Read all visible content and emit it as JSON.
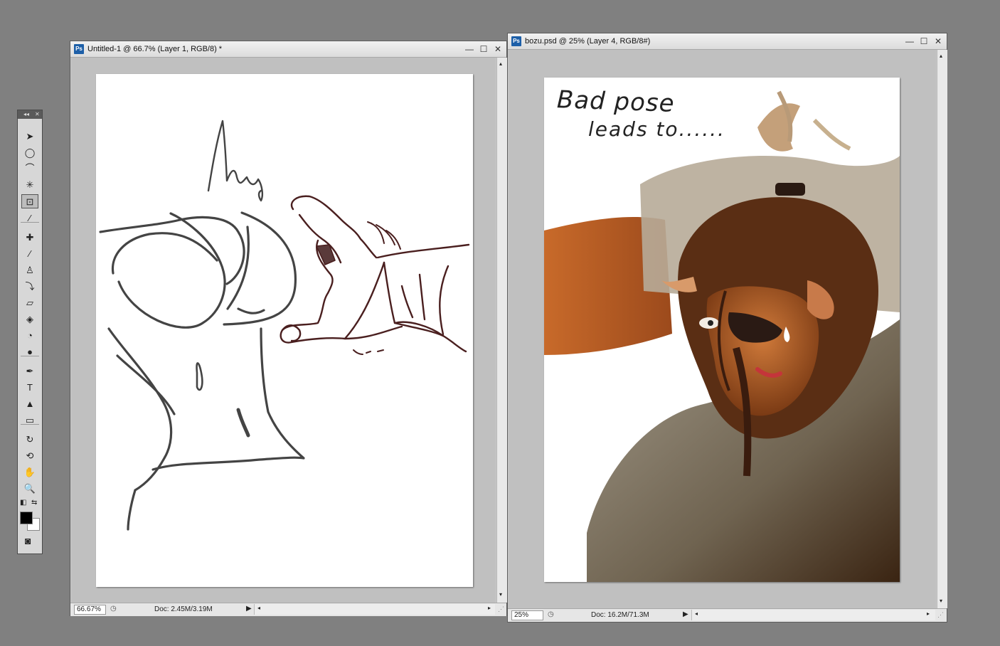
{
  "tools_panel": {
    "collapse_glyph": "◂◂",
    "close_glyph": "✕",
    "tools": [
      {
        "name": "move-tool-icon",
        "glyph": "➤"
      },
      {
        "name": "elliptical-marquee-tool-icon",
        "glyph": "◯"
      },
      {
        "name": "polygonal-lasso-tool-icon",
        "glyph": "⌒"
      },
      {
        "name": "magic-wand-tool-icon",
        "glyph": "✳"
      },
      {
        "name": "crop-tool-icon",
        "glyph": "⊡"
      },
      {
        "name": "eyedropper-tool-icon",
        "glyph": "⁄"
      },
      {
        "name": "healing-brush-tool-icon",
        "glyph": "✚"
      },
      {
        "name": "brush-tool-icon",
        "glyph": "∕"
      },
      {
        "name": "clone-stamp-tool-icon",
        "glyph": "♙"
      },
      {
        "name": "history-brush-tool-icon",
        "glyph": "⤵"
      },
      {
        "name": "eraser-tool-icon",
        "glyph": "▱"
      },
      {
        "name": "paint-bucket-tool-icon",
        "glyph": "◈"
      },
      {
        "name": "blur-tool-icon",
        "glyph": "◔"
      },
      {
        "name": "dodge-tool-icon",
        "glyph": "●"
      },
      {
        "name": "pen-tool-icon",
        "glyph": "✒"
      },
      {
        "name": "type-tool-icon",
        "glyph": "T"
      },
      {
        "name": "path-selection-tool-icon",
        "glyph": "▲"
      },
      {
        "name": "rectangle-tool-icon",
        "glyph": "▭"
      },
      {
        "name": "rotate-view-tool-icon",
        "glyph": "↻"
      },
      {
        "name": "3d-rotate-tool-icon",
        "glyph": "⟲"
      },
      {
        "name": "hand-tool-icon",
        "glyph": "✋"
      },
      {
        "name": "zoom-tool-icon",
        "glyph": "🔍"
      }
    ],
    "selected_tool": "crop-tool-icon",
    "foreground_color": "#000000",
    "background_color": "#ffffff",
    "default_colors_glyph": "◧",
    "swap_colors_glyph": "⇆",
    "quick_mask_glyph": "◙"
  },
  "window1": {
    "title": "Untitled-1 @ 66.7% (Layer 1, RGB/8) *",
    "ps_badge": "Ps",
    "minimize_glyph": "—",
    "maximize_glyph": "☐",
    "close_glyph": "✕",
    "zoom": "66.67%",
    "doc_info": "Doc: 2.45M/3.19M"
  },
  "window2": {
    "title": "bozu.psd @ 25% (Layer 4, RGB/8#)",
    "ps_badge": "Ps",
    "minimize_glyph": "—",
    "maximize_glyph": "☐",
    "close_glyph": "✕",
    "zoom": "25%",
    "doc_info": "Doc: 16.2M/71.3M",
    "handwritten_line1": "Bad pose",
    "handwritten_line2": "leads to......"
  },
  "colors": {
    "sketch_gray": "#444444",
    "sketch_brown": "#4a1f1f",
    "canvas_bg": "#c0c0c0"
  }
}
